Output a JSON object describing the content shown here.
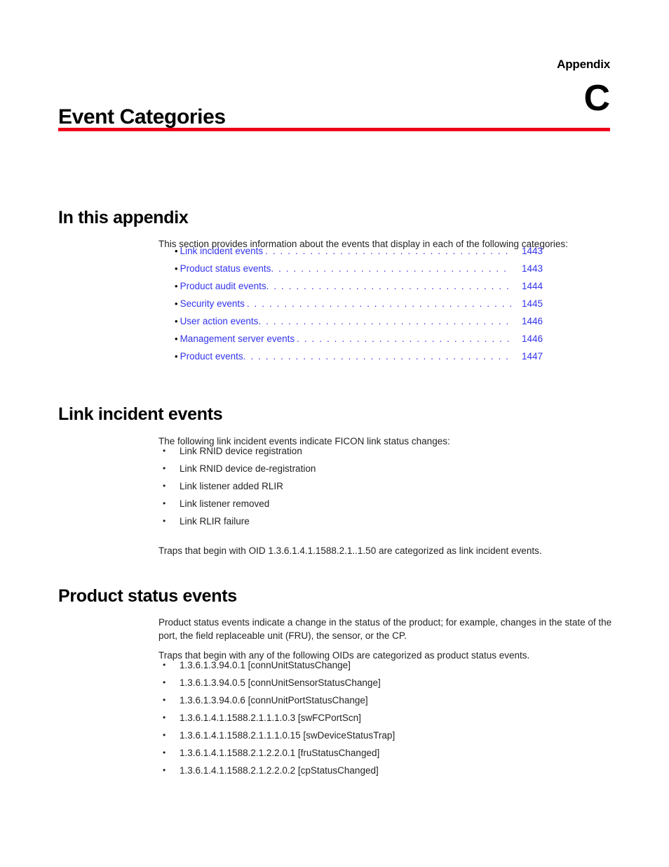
{
  "header": {
    "appendix_label": "Appendix",
    "appendix_letter": "C",
    "chapter_title": "Event Categories",
    "rule_color": "#ee0019"
  },
  "sections": {
    "in_this_appendix": {
      "heading": "In this appendix",
      "intro": "This section provides information about the events that display in each of the following categories:",
      "toc": [
        {
          "label": "Link incident events",
          "page": "1443"
        },
        {
          "label": "Product status events",
          "page": "1443"
        },
        {
          "label": "Product audit events",
          "page": "1444"
        },
        {
          "label": "Security events",
          "page": "1445"
        },
        {
          "label": "User action events",
          "page": "1446"
        },
        {
          "label": "Management server events",
          "page": "1446"
        },
        {
          "label": "Product events",
          "page": "1447"
        }
      ],
      "link_color": "#3333ee"
    },
    "link_incident_events": {
      "heading": "Link incident events",
      "lead": "The following link incident events indicate FICON link status changes:",
      "items": [
        "Link RNID device registration",
        "Link RNID device de-registration",
        "Link listener added RLIR",
        "Link listener removed",
        "Link RLIR failure"
      ],
      "traps": "Traps that begin with OID 1.3.6.1.4.1.1588.2.1..1.50 are categorized as link incident events."
    },
    "product_status_events": {
      "heading": "Product status events",
      "description": "Product status events indicate a change in the status of the product; for example, changes in the state of the port, the field replaceable unit (FRU), the sensor, or the CP.",
      "traps_intro": "Traps that begin with any of the following OIDs are categorized as product status events.",
      "oids": [
        "1.3.6.1.3.94.0.1 [connUnitStatusChange]",
        "1.3.6.1.3.94.0.5 [connUnitSensorStatusChange]",
        "1.3.6.1.3.94.0.6 [connUnitPortStatusChange]",
        "1.3.6.1.4.1.1588.2.1.1.1.0.3 [swFCPortScn]",
        "1.3.6.1.4.1.1588.2.1.1.1.0.15 [swDeviceStatusTrap]",
        "1.3.6.1.4.1.1588.2.1.2.2.0.1 [fruStatusChanged]",
        "1.3.6.1.4.1.1588.2.1.2.2.0.2 [cpStatusChanged]"
      ]
    }
  },
  "glyphs": {
    "bullet": "•",
    "leader_dots": ". . . . . . . . . . . . . . . . . . . . . . . . . . . . . . . . . . . . . . . . . . . . . . . . . . . . . . . . . . . ."
  }
}
